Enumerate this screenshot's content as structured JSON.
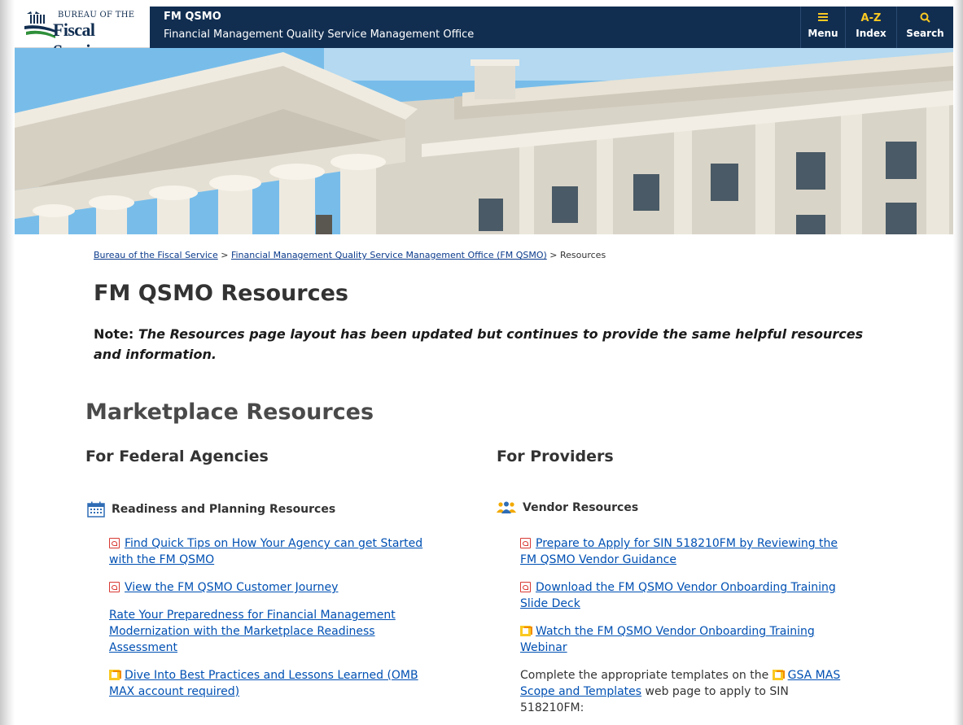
{
  "header": {
    "logo": {
      "top_line": "BUREAU OF THE",
      "main": "Fiscal Service"
    },
    "title": "FM QSMO",
    "subtitle": "Financial Management Quality Service Management Office",
    "nav": [
      {
        "icon": "menu-icon",
        "label": "Menu"
      },
      {
        "icon": "az-index-icon",
        "icon_text": "A-Z",
        "label": "Index"
      },
      {
        "icon": "search-icon",
        "label": "Search"
      }
    ],
    "accent_color": "#fac922",
    "background_color": "#112e51"
  },
  "breadcrumb": {
    "items": [
      "Bureau of the Fiscal Service",
      "Financial Management Quality Service Management Office (FM QSMO)",
      "Resources"
    ],
    "separator": ">"
  },
  "page_title": "FM QSMO Resources",
  "note": {
    "label": "Note:",
    "text": "The Resources page layout has been updated but continues to provide the same helpful resources and information."
  },
  "section_title": "Marketplace Resources",
  "columns": {
    "agencies": {
      "title": "For Federal Agencies",
      "subhead": "Readiness and Planning Resources",
      "subhead_icon": "calendar-icon",
      "items": [
        {
          "icon": "pdf-icon",
          "line1": "Find Quick Tips on How Your Agency can get Started",
          "line2": "with the FM QSMO"
        },
        {
          "icon": "pdf-icon",
          "line1": "View the FM QSMO Customer Journey"
        },
        {
          "icon": "none",
          "line1": "Rate Your Preparedness for Financial Management",
          "line2": "Modernization with the Marketplace Readiness",
          "line3": "Assessment"
        },
        {
          "icon": "external-link-icon",
          "line1": "Dive Into Best Practices and Lessons Learned (OMB",
          "line2": "MAX account required)"
        }
      ]
    },
    "providers": {
      "title": "For Providers",
      "subhead": "Vendor Resources",
      "subhead_icon": "people-group-icon",
      "items": [
        {
          "icon": "pdf-icon",
          "line1": "Prepare to Apply for SIN 518210FM by Reviewing the",
          "line2": "FM QSMO Vendor Guidance"
        },
        {
          "icon": "pdf-icon",
          "line1": "Download the FM QSMO Vendor Onboarding Training",
          "line2": "Slide Deck"
        },
        {
          "icon": "external-link-icon",
          "line1": "Watch the FM QSMO Vendor Onboarding Training",
          "line2": "Webinar"
        }
      ],
      "templates_paragraph": {
        "before": "Complete the appropriate templates on the",
        "link1": "GSA MAS",
        "link2": "Scope and Templates",
        "after": "web page to apply to SIN",
        "line3": "518210FM:"
      }
    }
  }
}
